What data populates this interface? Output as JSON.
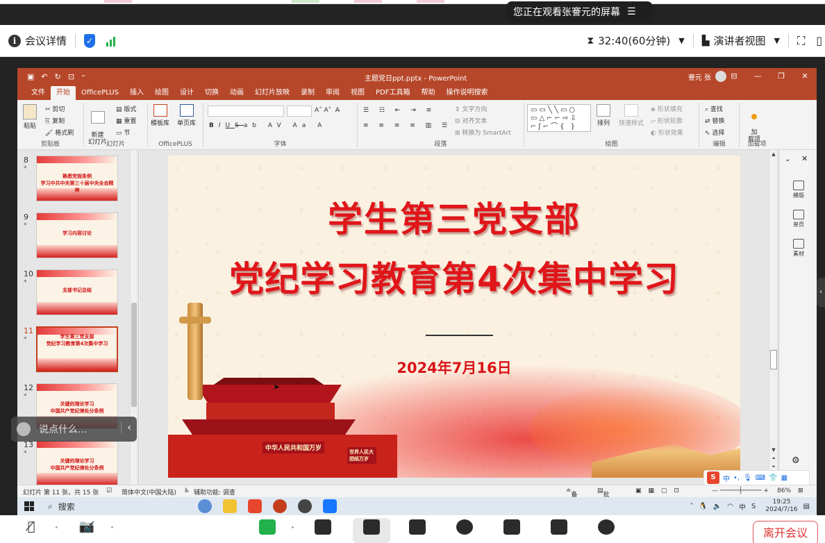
{
  "share_banner": {
    "text": "您正在观看张謇元的屏幕",
    "menu_icon": "list-icon"
  },
  "meeting_bar": {
    "details_label": "会议详情",
    "timer": "32:40(60分钟)",
    "view_label": "演讲者视图"
  },
  "ppt": {
    "doc_title": "主题党日ppt.pptx - PowerPoint",
    "user_name": "謇元 张",
    "tabs": [
      "文件",
      "开始",
      "OfficePLUS",
      "插入",
      "绘图",
      "设计",
      "切换",
      "动画",
      "幻灯片放映",
      "录制",
      "审阅",
      "视图",
      "PDF工具箱",
      "帮助",
      "操作说明搜索"
    ],
    "active_tab": "开始",
    "ribbon": {
      "clipboard": {
        "paste": "粘贴",
        "cut": "剪切",
        "copy": "复制",
        "format_painter": "格式刷",
        "group": "剪贴板"
      },
      "slides": {
        "new_slide": "新建\n幻灯片",
        "layout": "版式",
        "reset": "重置",
        "section": "节",
        "group": "幻灯片"
      },
      "officeplus": {
        "template": "模板库",
        "single_page": "单页库",
        "group": "OfficePLUS"
      },
      "font": {
        "bold": "B",
        "italic": "I",
        "underline": "U",
        "strike": "S",
        "group": "字体"
      },
      "paragraph": {
        "text_direction": "文字方向",
        "align_text": "对齐文本",
        "smartart": "转换为 SmartArt",
        "group": "段落"
      },
      "drawing": {
        "arrange": "排列",
        "quick_styles": "快速样式",
        "fill": "形状填充",
        "outline": "形状轮廓",
        "effects": "形状效果",
        "group": "绘图"
      },
      "editing": {
        "find": "查找",
        "replace": "替换",
        "select": "选择",
        "group": "编辑"
      },
      "addins": {
        "label": "加\n载项",
        "group": "加载项"
      }
    },
    "thumbnails": [
      {
        "num": "8",
        "title": "熟悉党规条例\n学习中共中央第三十届中央全会精神",
        "selected": false
      },
      {
        "num": "9",
        "title": "学习内容讨论",
        "selected": false
      },
      {
        "num": "10",
        "title": "支部书记总结",
        "selected": false
      },
      {
        "num": "11",
        "title": "学生第三党支部\n党纪学习教育第4次集中学习",
        "selected": true
      },
      {
        "num": "12",
        "title": "关键的理论学习\n中国共产党纪律处分条例",
        "selected": false
      },
      {
        "num": "13",
        "title": "关键的理论学习\n中国共产党纪律处分条例",
        "selected": false
      }
    ],
    "slide": {
      "title1": "学生第三党支部",
      "title2": "党纪学习教育第4次集中学习",
      "date": "2024年7月16日",
      "gate_banner": "中华人民共和国万岁",
      "gate_banner2": "世界人民大团结万岁"
    },
    "side_pane": [
      {
        "label": "模版"
      },
      {
        "label": "单页"
      },
      {
        "label": "素材"
      }
    ],
    "status": {
      "slide_info": "幻灯片 第 11 张，共 15 张",
      "language": "简体中文(中国大陆)",
      "accessibility": "辅助功能: 调查",
      "notes": "备注",
      "comments": "批注",
      "zoom": "86%"
    }
  },
  "chat": {
    "placeholder": "说点什么..."
  },
  "ime": {
    "mode": "中"
  },
  "taskbar": {
    "search": "搜索",
    "time": "19:25",
    "date": "2024/7/16"
  },
  "controls": {
    "leave": "离开会议"
  }
}
